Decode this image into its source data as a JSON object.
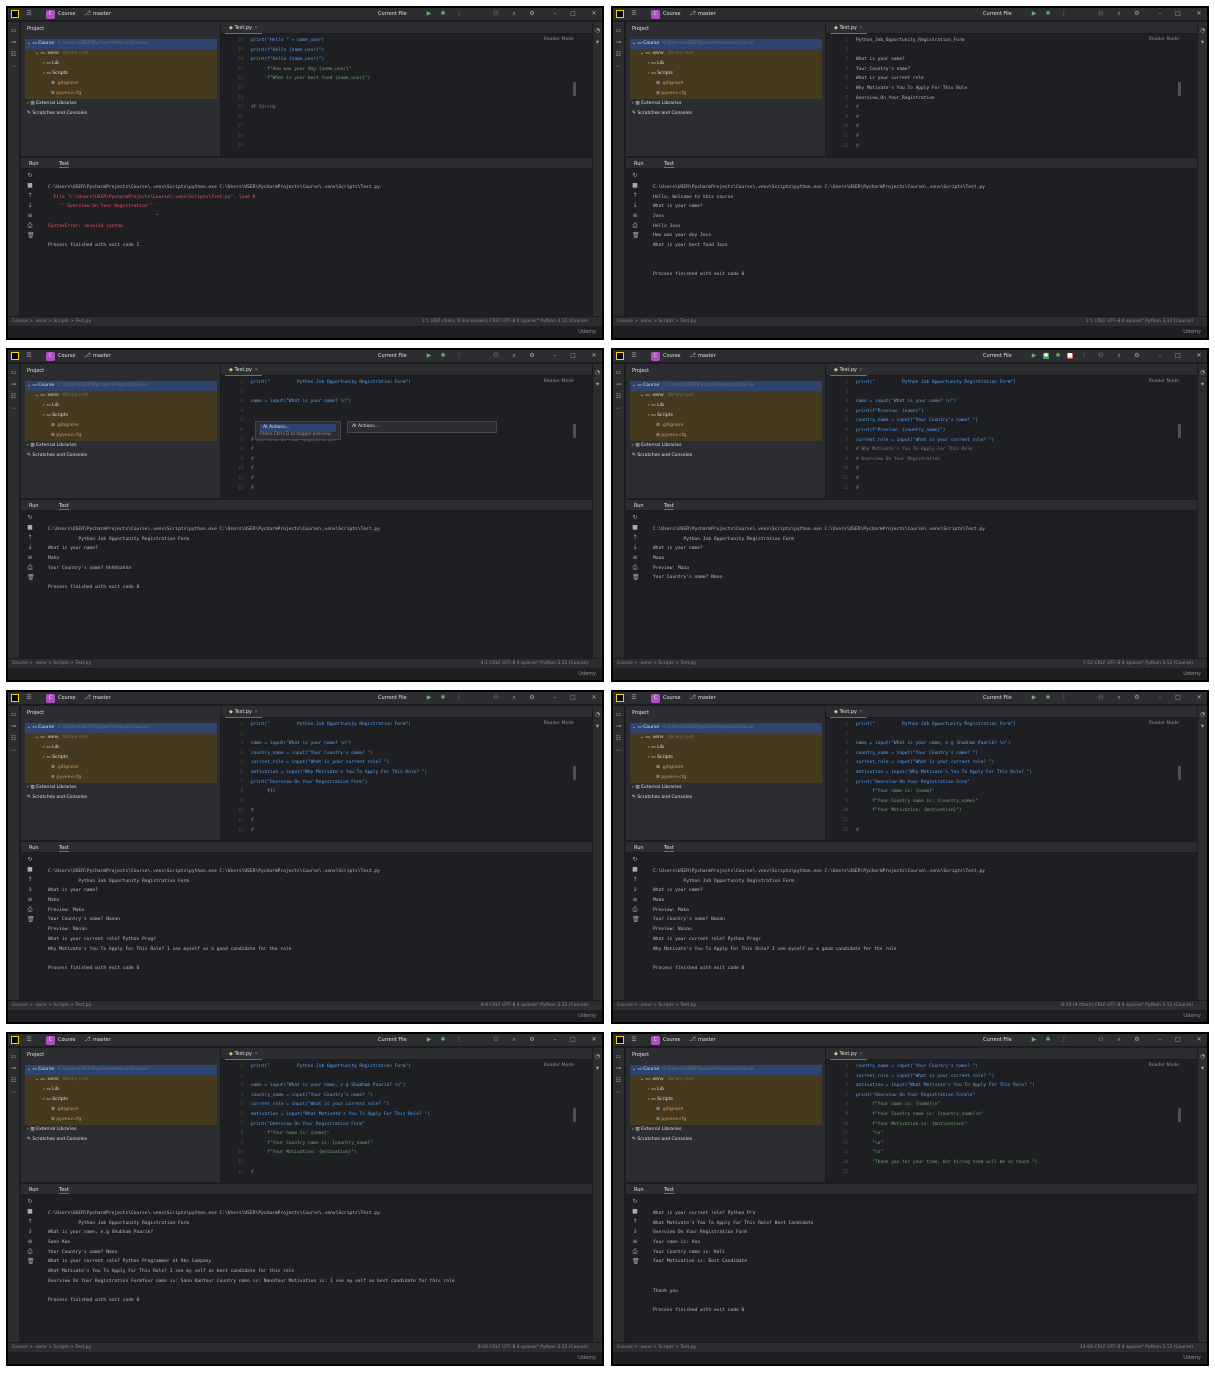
{
  "common": {
    "project_badge": "C",
    "project_name": "Course",
    "branch": "master",
    "run_config": "Current File",
    "project_label": "Project",
    "tree": {
      "root": "Course",
      "root_path": "C:\\Users\\USER\\PycharmProjects\\Course",
      "venv": ".venv",
      "venv_note": "library root",
      "lib": "Lib",
      "scripts": "Scripts",
      "gitignore": ".gitignore",
      "pyvenv": "pyvenv.cfg",
      "external": "External Libraries",
      "scratches": "Scratches and Consoles"
    },
    "tab_label": "Test.py",
    "reader_mode": "Reader Mode",
    "run_label": "Run",
    "run_tab": "Test",
    "breadcrumb": "Course  >  .venv  >  Scripts  >  Test.py",
    "status_right": "CRLF    UTF-8    4 spaces*    Python 3.12 (Course)",
    "watermark": "Udemy",
    "colors": {
      "bg": "#1e1f22",
      "panel": "#2b2d30",
      "accent": "#3574f0",
      "run": "#5fb85f",
      "error": "#f75464"
    }
  },
  "panels": [
    {
      "id": 1,
      "position": "1:1 (287 chars, 6 line breaks)",
      "gutter": [
        "18",
        "19",
        "20",
        "21",
        "22",
        "23",
        "24",
        "25",
        "26",
        "27",
        "28",
        "29"
      ],
      "code": [
        "print(\"Hello \" + name_user)",
        "print(f\"Hello {name_user}\")",
        "print(f\"Hello {name_user}\")",
        "      f\"How was your day {name_user}\"",
        "      f\"What is your best food {name_user}\")",
        "",
        "",
        "#F-String",
        "",
        "",
        "",
        ""
      ],
      "console": [
        "C:\\Users\\USER\\PycharmProjects\\Course\\.venv\\Scripts\\python.exe C:\\Users\\USER\\PycharmProjects\\Course\\.venv\\Scripts\\Test.py",
        "  File \"C:\\Users\\USER\\PycharmProjects\\Course\\.venv\\Scripts\\Test.py\", line 8",
        "    '''Overview On Your Registration'''",
        "                                       ^",
        "SyntaxError: invalid syntax",
        "",
        "Process finished with exit code 1"
      ]
    },
    {
      "id": 2,
      "position": "1:1",
      "gutter": [
        "1",
        "2",
        "3",
        "4",
        "5",
        "6",
        "7",
        "8",
        "9",
        "10",
        "11",
        "12"
      ],
      "code": [
        "Python_Job_Opportunity_Registration_Form",
        "",
        "What is your name?",
        "Your_Country's name?",
        "What is your current role",
        "Why Motivate's You To Apply For This Role",
        "Overview_On_Your_Registration",
        "#",
        "#",
        "#",
        "#",
        "#"
      ],
      "console": [
        "C:\\Users\\USER\\PycharmProjects\\Course\\.venv\\Scripts\\python.exe C:\\Users\\USER\\PycharmProjects\\Course\\.venv\\Scripts\\Test.py",
        "Hello, Welcome to this course",
        "What is your name?",
        "Joss",
        "Hello Joss",
        "How was your day Joss",
        "What is your best food Joss",
        "",
        "",
        "Process finished with exit code 0"
      ]
    },
    {
      "id": 3,
      "position": "4:1",
      "gutter": [
        "1",
        "2",
        "3",
        "4",
        "5",
        "6",
        "7",
        "8",
        "9",
        "10",
        "11",
        "12"
      ],
      "code": [
        "print(\"          Python Job Opportunity Registration Form\")",
        "",
        "name = input(\"What is your name? \\n\")",
        "",
        "",
        "         ty For This Role",
        "# Overview On Your Registration",
        "#",
        "#",
        "#",
        "#",
        "#"
      ],
      "popup_items": [
        "AI Actions...",
        "Press Ctrl+Q to toggle preview",
        "AI Actions..."
      ],
      "console": [
        "C:\\Users\\USER\\PycharmProjects\\Course\\.venv\\Scripts\\python.exe C:\\Users\\USER\\PycharmProjects\\Course\\.venv\\Scripts\\Test.py",
        "           Python Job Opportunity Registration Form",
        "What is your name?",
        "Maka",
        "Your Country's name? hhhhhahha",
        "",
        "Process finished with exit code 0"
      ]
    },
    {
      "id": 4,
      "position": "7:52",
      "gutter": [
        "1",
        "2",
        "3",
        "4",
        "5",
        "6",
        "7",
        "8",
        "9",
        "10",
        "11",
        "12"
      ],
      "code": [
        "print(\"          Python Job Opportunity Registration Form\")",
        "",
        "name = input(\"What is your name? \\n\")",
        "print(f\"Preview: {name}\")",
        "country_name = input(\"Your Country's name? \")",
        "print(f\"Preview: {country_name}\")",
        "current_role = input(\"What is your current role? \")",
        "# Why Motivate's You To Apply For This Role",
        "# Overview On Your Registration",
        "#",
        "#",
        "#"
      ],
      "console": [
        "C:\\Users\\USER\\PycharmProjects\\Course\\.venv\\Scripts\\python.exe C:\\Users\\USER\\PycharmProjects\\Course\\.venv\\Scripts\\Test.py",
        "           Python Job Opportunity Registration Form",
        "What is your name?",
        "Maaa",
        "Preview: Maaa",
        "Your Country's name? Nana"
      ]
    },
    {
      "id": 5,
      "position": "8:8",
      "gutter": [
        "1",
        "2",
        "3",
        "4",
        "5",
        "6",
        "7",
        "8",
        "9",
        "10",
        "11",
        "12"
      ],
      "code": [
        "print(\"          Python Job Opportunity Registration Form\")",
        "",
        "name = input(\"What is your name? \\n\")",
        "country_name = input(\"Your Country's name? \")",
        "current_role = input(\"What is your current role? \")",
        "motivation = input(\"Why Motivate's You To Apply For This Role? \")",
        "print(\"Overview On Your Registration Form\")",
        "      f()",
        "",
        "#",
        "#",
        "#"
      ],
      "console": [
        "C:\\Users\\USER\\PycharmProjects\\Course\\.venv\\Scripts\\python.exe C:\\Users\\USER\\PycharmProjects\\Course\\.venv\\Scripts\\Test.py",
        "           Python Job Opportunity Registration Form",
        "What is your name?",
        "Maka",
        "Preview: Maka",
        "Your Country's name? Nanan",
        "Preview: Nanan",
        "What is your current role? Python Progr",
        "Why Motivate's You To Apply For This Role? I see myself as a good candidate for the role",
        "",
        "Process finished with exit code 0"
      ]
    },
    {
      "id": 6,
      "position": "6:10 (9 chars)",
      "gutter": [
        "1",
        "2",
        "3",
        "4",
        "5",
        "6",
        "7",
        "8",
        "9",
        "10",
        "11",
        "12"
      ],
      "code": [
        "print(\"          Python Job Opportunity Registration Form\")",
        "",
        "name = input(\"What is your name, e.g Shubham Paarik? \\n\")",
        "country_name = input(\"Your Country's name? \")",
        "current_role = input(\"What is your current role? \")",
        "motivation = input(\"Why Motivate's You To Apply For This Role? \")",
        "print(\"Overview On Your Registration Form\"",
        "      f\"Your name is: {name}\"",
        "      f\"Your Country name is: {country_name}\"",
        "      f\"Your Motivation: {motivation}\")",
        "",
        "#"
      ],
      "console": [
        "C:\\Users\\USER\\PycharmProjects\\Course\\.venv\\Scripts\\python.exe C:\\Users\\USER\\PycharmProjects\\Course\\.venv\\Scripts\\Test.py",
        "           Python Job Opportunity Registration Form",
        "What is your name?",
        "Maka",
        "Preview: Maka",
        "Your Country's name? Nanan",
        "Preview: Nanan",
        "What is your current role? Python Progr",
        "Why Motivate's You To Apply For This Role? I see myself as a good candidate for the role",
        "",
        "Process finished with exit code 0"
      ]
    },
    {
      "id": 7,
      "position": "8:26",
      "gutter": [
        "1",
        "2",
        "3",
        "4",
        "5",
        "6",
        "7",
        "8",
        "9",
        "10",
        "11",
        "12"
      ],
      "code": [
        "print(\"          Python Job Opportunity Registration Form\")",
        "",
        "name = input(\"What is your name, e.g Shubham Paarik? \\n\")",
        "country_name = input(\"Your Country's name? \")",
        "current_role = input(\"What is your current role? \")",
        "motivation = input(\"What Motivate's You To Apply For This Role? \")",
        "print(\"Overview On Your Registration Form\"",
        "      f\"Your name is: {name}\"",
        "      f\"Your Country name is: {country_name}\"",
        "      f\"Your Motivation: {motivation}\")",
        "",
        "#"
      ],
      "console": [
        "C:\\Users\\USER\\PycharmProjects\\Course\\.venv\\Scripts\\python.exe C:\\Users\\USER\\PycharmProjects\\Course\\.venv\\Scripts\\Test.py",
        "           Python Job Opportunity Registration Form",
        "What is your name, e.g Shubham Paarik?",
        "Sana Kan",
        "Your Country's name? Nana",
        "What is your current role? Python Programmer at Abc Company",
        "What Motivate's You To Apply For This Role? I see my self as best candidate for this role",
        "Overview On Your Registration FormYour name is: Sana KanYour Country name is: NanaYour Motivation is: I see my self as best candidate for this role",
        "",
        "Process finished with exit code 0"
      ]
    },
    {
      "id": 8,
      "position": "14:66",
      "gutter": [
        "4",
        "5",
        "6",
        "7",
        "8",
        "9",
        "10",
        "11",
        "12",
        "13",
        "14",
        "15"
      ],
      "code": [
        "country_name = input(\"Your Country's name? \")",
        "current_role = input(\"What is your current role? \")",
        "motivation = input(\"What Motivate's You To Apply For This Role? \")",
        "print(\"Overview On Your Registration Form\\n\"",
        "      f\"Your name is: {name}\\n\"",
        "      f\"Your Country name is: {country_name}\\n\"",
        "      f\"Your Motivation is: {motivation}\"",
        "      \"\\n\"",
        "      \"\\n\"",
        "      \"\\n\"",
        "      \"Thank you for your time, Our hiring team will be in touch \")",
        ""
      ],
      "console": [
        "What is your current role? Python Pro",
        "What Motivate's You To Apply For This Role? Best Candidate",
        "Overview On Your Registration Form",
        "Your name is: Ana",
        "Your Country name is: Kali",
        "Your Motivation is: Best Candidate",
        "",
        "",
        "Thank you",
        "",
        "Process finished with exit code 0"
      ]
    }
  ]
}
